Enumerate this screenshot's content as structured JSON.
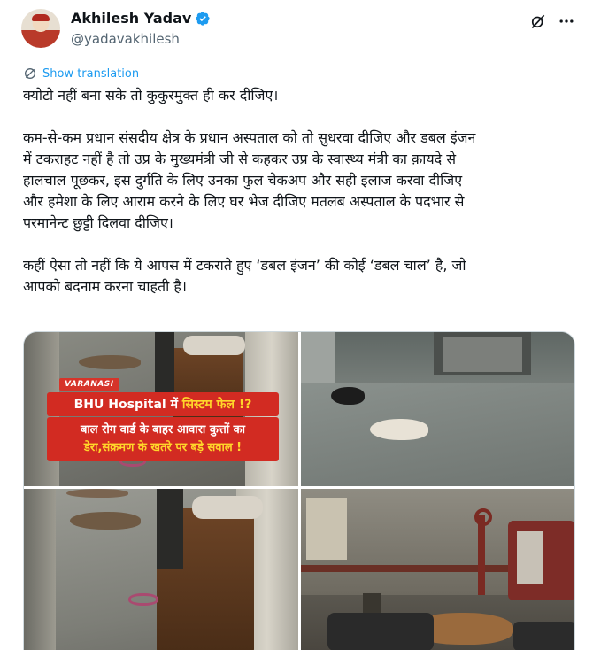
{
  "author": {
    "name": "Akhilesh Yadav",
    "handle": "@yadavakhilesh",
    "verified": true
  },
  "actions": {
    "grok_icon": "grok-icon",
    "more_icon": "more-icon"
  },
  "translation": {
    "label": "Show translation"
  },
  "tweet": {
    "line1": "क्योटो नहीं बना सके तो कुकुरमुक्त ही कर दीजिए।",
    "para2": [
      "कम-से-कम प्रधान संसदीय क्षेत्र के प्रधान अस्पताल को तो सुधरवा दीजिए और डबल इंजन",
      "में टकराहट नहीं है तो उप्र के मुख्यमंत्री जी से कहकर उप्र के स्वास्थ्य मंत्री का क़ायदे से",
      "हालचाल पूछकर, इस दुर्गति के लिए उनका फुल चेकअप और सही इलाज करवा दीजिए",
      "और हमेशा के लिए आराम करने के लिए घर भेज दीजिए मतलब अस्पताल के पदभार से",
      "परमानेन्ट छुट्टी दिलवा दीजिए।"
    ],
    "para3": [
      "कहीं ऐसा तो नहीं कि ये आपस में टकराते हुए ‘डबल इंजन’ की कोई ‘डबल चाल’ है, जो",
      "आपको बदनाम करना चाहती है।"
    ]
  },
  "media": {
    "tag": "VARANASI",
    "headline_prefix": "BHU Hospital में ",
    "headline_highlight": "सिस्टम फेल !?",
    "sub_line1": "बाल रोग वार्ड के बाहर आवारा कुत्तों का",
    "sub_line2": "डेरा,संक्रमण के खतरे पर बड़े सवाल !"
  },
  "colors": {
    "link": "#1d9bf0",
    "verified": "#1d9bf0",
    "banner_red": "#d22b22",
    "banner_yellow": "#ffd52a"
  }
}
